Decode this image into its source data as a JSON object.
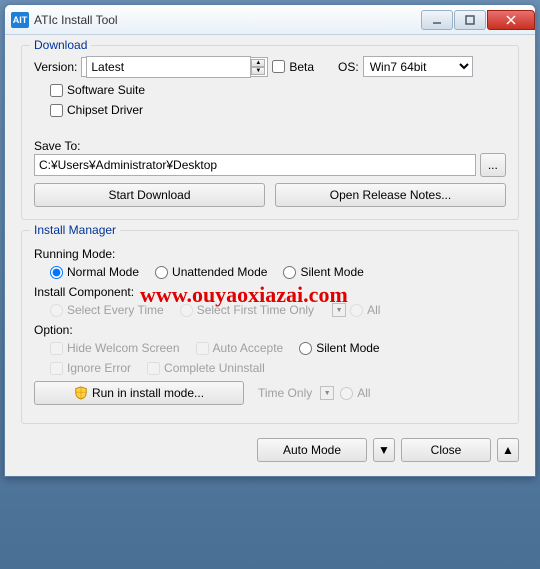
{
  "titlebar": {
    "title": "ATIc Install Tool",
    "icon": "AIT"
  },
  "download": {
    "group_title": "Download",
    "version_label": "Version:",
    "version_value": "Latest",
    "beta_label": "Beta",
    "os_label": "OS:",
    "os_value": "Win7 64bit",
    "software_suite": "Software Suite",
    "chipset_driver": "Chipset Driver",
    "save_to_label": "Save To:",
    "save_to_value": "C:¥Users¥Administrator¥Desktop",
    "browse": "...",
    "start_download": "Start Download",
    "release_notes": "Open Release Notes..."
  },
  "install": {
    "group_title": "Install Manager",
    "running_mode_label": "Running Mode:",
    "normal": "Normal Mode",
    "unattended": "Unattended Mode",
    "silent": "Silent Mode",
    "install_component_label": "Install Component:",
    "select_every": "Select Every Time",
    "select_first": "Select First Time Only",
    "all": "All",
    "option_label": "Option:",
    "hide_welcome": "Hide Welcom Screen",
    "auto_accepte": "Auto Accepte",
    "silent_opt": "Silent Mode",
    "ignore_error": "Ignore Error",
    "complete_uninstall": "Complete Uninstall",
    "run_install": "Run in install mode...",
    "time_only": "Time Only",
    "all2": "All"
  },
  "footer": {
    "auto_mode": "Auto Mode",
    "close": "Close"
  },
  "watermark": "www.ouyaoxiazai.com"
}
